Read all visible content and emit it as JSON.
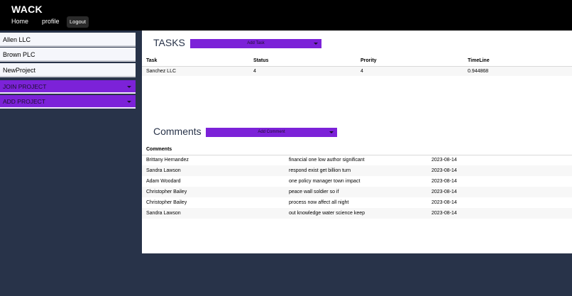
{
  "header": {
    "brand": "WACK",
    "nav": {
      "home": "Home",
      "profile": "profile",
      "logout": "Logout"
    }
  },
  "sidebar": {
    "projects": [
      "Allen LLC",
      "Brown PLC",
      "NewProject"
    ],
    "join_label": "JOIN PROJECT",
    "add_label": "ADD PROJECT"
  },
  "tasks": {
    "title": "TASKS",
    "add_label": "Add Task",
    "columns": [
      "Task",
      "Status",
      "Prority",
      "TimeLine"
    ],
    "rows": [
      [
        "Sanchez LLC",
        "4",
        "4",
        "0.944868"
      ]
    ]
  },
  "comments": {
    "title": "Comments",
    "add_label": "Add Comment",
    "column": "Comments",
    "rows": [
      [
        "Brittany Hernandez",
        "financial one low author significant",
        "2023-08-14"
      ],
      [
        "Sandra Lawson",
        "respond exist get billion turn",
        "2023-08-14"
      ],
      [
        "Adam Woodard",
        "one policy manager town impact",
        "2023-08-14"
      ],
      [
        "Christopher Bailey",
        "peace wall soldier so if",
        "2023-08-14"
      ],
      [
        "Christopher Bailey",
        "process now affect all night",
        "2023-08-14"
      ],
      [
        "Sandra Lawson",
        "out knowledge water science keep",
        "2023-08-14"
      ]
    ]
  },
  "colors": {
    "page_bg": "#283349",
    "header_bg": "#000000",
    "accent": "#7c22d8"
  }
}
